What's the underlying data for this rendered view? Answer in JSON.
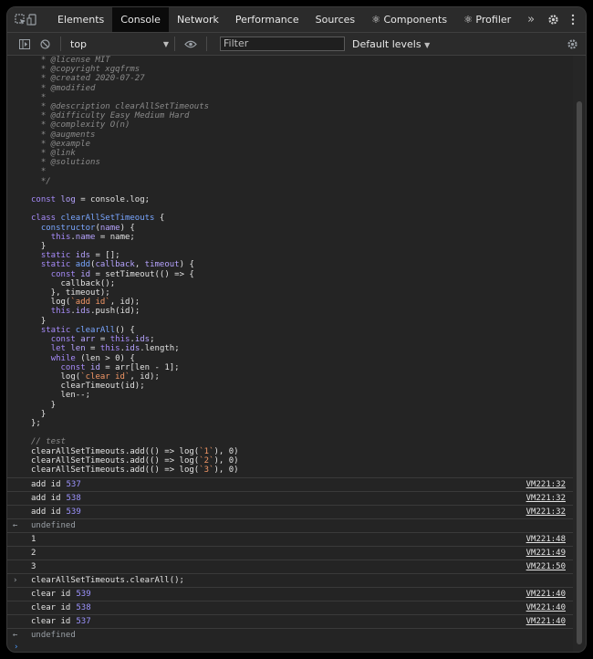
{
  "tabs": [
    "Elements",
    "Console",
    "Network",
    "Performance",
    "Sources",
    "⚛ Components",
    "⚛ Profiler"
  ],
  "more_tabs": "»",
  "toolbar": {
    "context": "top",
    "filter_placeholder": "Filter",
    "levels": "Default levels"
  },
  "logs": [
    {
      "text": "add id",
      "id": "537",
      "source": "VM221:32"
    },
    {
      "text": "add id",
      "id": "538",
      "source": "VM221:32"
    },
    {
      "text": "add id",
      "id": "539",
      "source": "VM221:32"
    }
  ],
  "result1": "undefined",
  "logs2": [
    {
      "text": "1",
      "source": "VM221:48"
    },
    {
      "text": "2",
      "source": "VM221:49"
    },
    {
      "text": "3",
      "source": "VM221:50"
    }
  ],
  "command2": "clearAllSetTimeouts.clearAll();",
  "logs3": [
    {
      "text": "clear id",
      "id": "539",
      "source": "VM221:40"
    },
    {
      "text": "clear id",
      "id": "538",
      "source": "VM221:40"
    },
    {
      "text": "clear id",
      "id": "537",
      "source": "VM221:40"
    }
  ],
  "result2": "undefined",
  "icons": {
    "inspect": "inspect-element-icon",
    "device": "device-toggle-icon",
    "settings": "gear-icon",
    "menu": "kebab-menu-icon",
    "close": "close-icon",
    "sidebar": "sidebar-toggle-icon",
    "clear": "clear-console-icon",
    "eye": "eye-icon"
  },
  "colors": {
    "accent_number": "#9d94ff",
    "keyword": "#a78bfa",
    "function": "#79a6ff",
    "string": "#f29766"
  }
}
